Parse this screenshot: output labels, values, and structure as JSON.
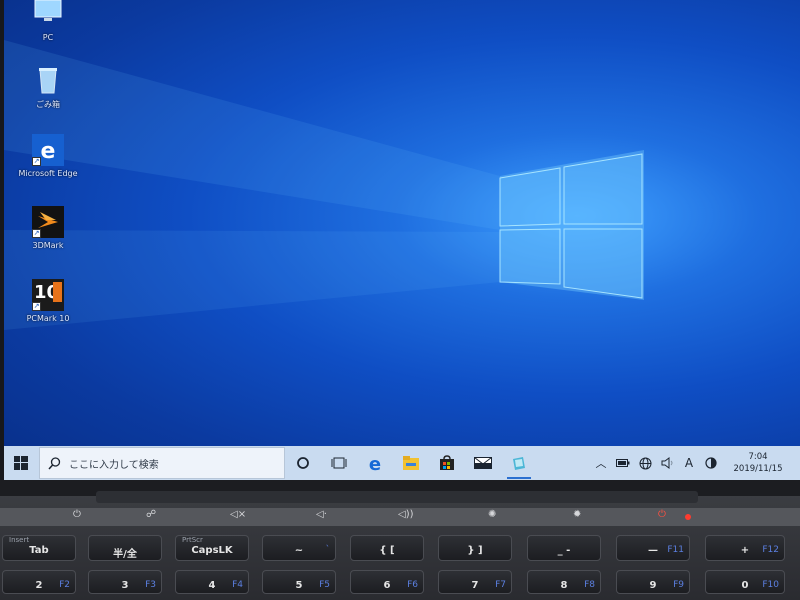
{
  "desktop": {
    "icons": [
      {
        "label": "PC",
        "icon": "pc-icon"
      },
      {
        "label": "ごみ箱",
        "icon": "recycle-bin-icon"
      },
      {
        "label": "Microsoft Edge",
        "icon": "edge-icon"
      },
      {
        "label": "3DMark",
        "icon": "3dmark-icon"
      },
      {
        "label": "PCMark 10",
        "icon": "pcmark-icon",
        "badge": "10"
      }
    ]
  },
  "taskbar": {
    "search_placeholder": "ここに入力して検索",
    "apps": [
      "cortana-icon",
      "task-view-icon",
      "edge-icon",
      "file-explorer-icon",
      "store-icon",
      "mail-icon",
      "pinned-app-icon"
    ],
    "tray": {
      "ime_mode": "A",
      "time": "7:04",
      "date": "2019/11/15"
    }
  },
  "keyboard": {
    "row1": [
      {
        "top": "Insert",
        "main": "Tab"
      },
      {
        "main": "半/全"
      },
      {
        "top": "PrtScr",
        "main": "CapsLK"
      },
      {
        "main": "~",
        "sub": "`"
      },
      {
        "main": "{  ["
      },
      {
        "main": "}  ]"
      },
      {
        "main": "_  -"
      },
      {
        "main": "—",
        "sub": "F11"
      },
      {
        "main": "+",
        "sub": "F12"
      }
    ],
    "row2": [
      {
        "main": "2",
        "sub": "F2"
      },
      {
        "main": "3",
        "sub": "F3"
      },
      {
        "main": "4",
        "sub": "F4"
      },
      {
        "main": "5",
        "sub": "F5"
      },
      {
        "main": "6",
        "sub": "F6"
      },
      {
        "main": "7",
        "sub": "F7"
      },
      {
        "main": "8",
        "sub": "F8"
      },
      {
        "main": "9",
        "sub": "F9"
      },
      {
        "main": "0",
        "sub": "F10"
      }
    ]
  },
  "colors": {
    "wallpaper_blue": "#0f4ec4",
    "taskbar_bg": "#c9dbf0",
    "power_led": "#ff3b2f"
  }
}
